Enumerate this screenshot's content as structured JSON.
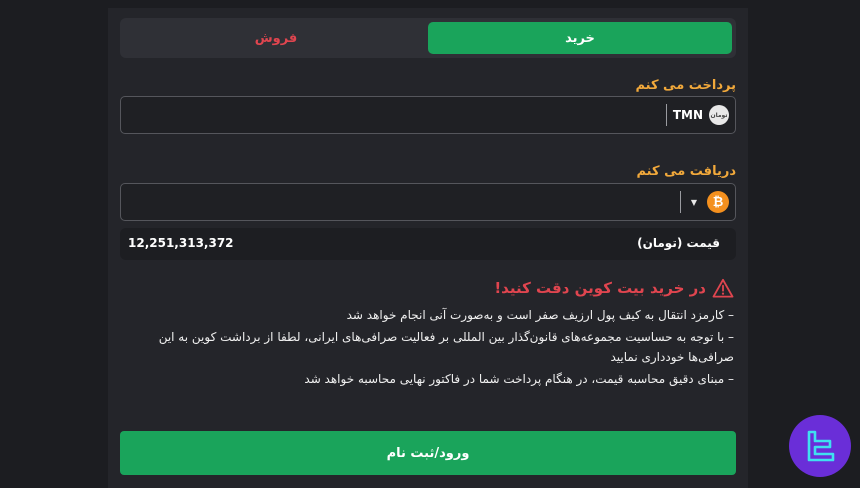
{
  "tabs": {
    "buy": "خرید",
    "sell": "فروش"
  },
  "pay": {
    "label": "پرداخت می کنم",
    "currency": "TMN",
    "currency_icon_text": "تومان"
  },
  "receive": {
    "label": "دریافت می کنم",
    "currency_icon": "₿"
  },
  "price": {
    "label": "قیمت (تومان)",
    "value": "12,251,313,372"
  },
  "warning": {
    "title": "در خرید بیت کوین دقت کنید!",
    "notes": [
      "– کارمزد انتقال به کیف پول ارزیف صفر است و به‌صورت آنی انجام خواهد شد",
      "– با توجه به حساسیت مجموعه‌های قانون‌گذار بین المللی بر فعالیت صرافی‌های ایرانی، لطفا از برداشت کوین به این صرافی‌ها خودداری نمایید",
      "– مبنای دقیق محاسبه قیمت، در هنگام پرداخت شما در فاکتور نهایی محاسبه خواهد شد"
    ]
  },
  "cta": {
    "label": "ورود/ثبت نام"
  },
  "colors": {
    "green": "#1aa45b",
    "red": "#e0454f",
    "orange": "#f2a93b",
    "logo": "#6a2ed8"
  }
}
